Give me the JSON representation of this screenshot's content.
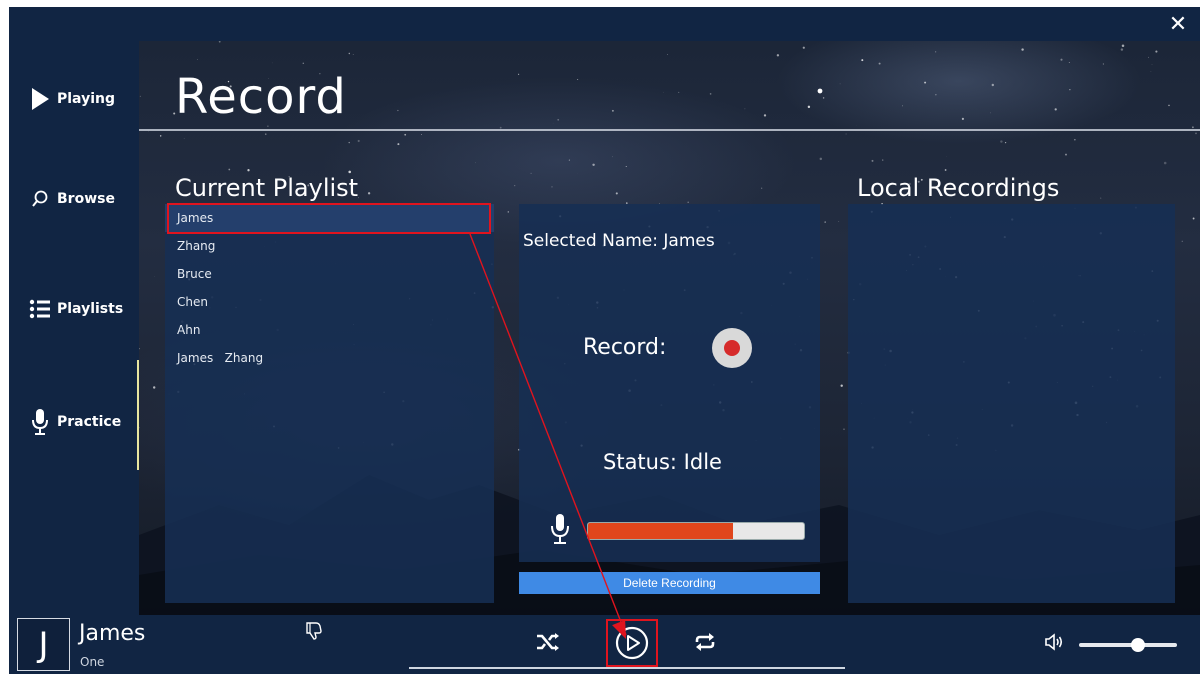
{
  "window": {
    "close_label": "✕"
  },
  "sidebar": {
    "items": [
      {
        "label": "Playing",
        "icon": "play-icon"
      },
      {
        "label": "Browse",
        "icon": "search-icon"
      },
      {
        "label": "Playlists",
        "icon": "list-icon"
      },
      {
        "label": "Practice",
        "icon": "microphone-icon"
      }
    ],
    "active": "Practice"
  },
  "header": {
    "title": "Record"
  },
  "playlist": {
    "title": "Current Playlist",
    "items": [
      "James",
      "Zhang",
      "Bruce",
      "Chen",
      "Ahn",
      "James   Zhang"
    ],
    "selected_index": 0
  },
  "detail": {
    "selected_name": "Selected Name: James",
    "record_label": "Record:",
    "status": "Status: Idle",
    "level_fraction": 0.67,
    "delete_label": "Delete Recording"
  },
  "recordings": {
    "title": "Local Recordings"
  },
  "player": {
    "art_letter": "J",
    "track_title": "James",
    "track_artist": "One",
    "volume_fraction": 0.6
  },
  "colors": {
    "background": "#112543",
    "panel": "#162e54",
    "accent_blue": "#3f8ae5",
    "level_orange": "#e0461c",
    "record_red": "#d62b2b",
    "annotation_red": "#e0141e"
  }
}
